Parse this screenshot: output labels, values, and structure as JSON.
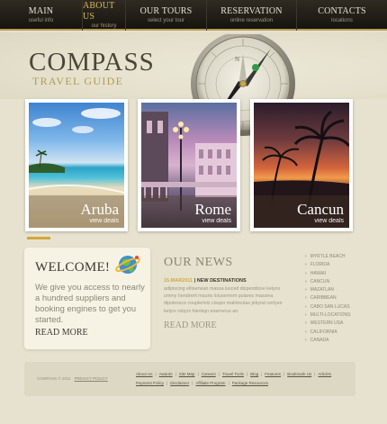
{
  "nav": [
    {
      "title": "MAIN",
      "sub": "useful info",
      "active": false
    },
    {
      "title": "ABOUT US",
      "sub": "our history",
      "active": true
    },
    {
      "title": "OUR TOURS",
      "sub": "select your tour",
      "active": false
    },
    {
      "title": "RESERVATION",
      "sub": "online reservation",
      "active": false
    },
    {
      "title": "CONTACTS",
      "sub": "locations",
      "active": false
    }
  ],
  "header": {
    "logo": "COMPASS",
    "tagline": "TRAVEL GUIDE"
  },
  "cards": [
    {
      "name": "Aruba",
      "link": "view deals"
    },
    {
      "name": "Rome",
      "link": "view deals"
    },
    {
      "name": "Cancun",
      "link": "view deals"
    }
  ],
  "welcome": {
    "title": "WELCOME!",
    "text": "We give you access to nearly a hundred suppliers and booking engines to get you started.",
    "more": "READ MORE"
  },
  "news": {
    "title": "OUR NEWS",
    "date": "15.MAR2011",
    "headline": "NEW DESTINATIONS",
    "body": "adipiscing elitaenean massa lusced dispendisse kelyox ummy hendrerit mauris loluserrism pulares massiea dipolessce couplerivis cisupo maliniculas jekyrat cerlyen kelyrx rebyrx hlenkqn enamvrus an.",
    "more": "READ MORE"
  },
  "destinations": [
    "MYRTLE BEACH",
    "FLORIDA",
    "HAWAII",
    "CANCUN",
    "MAZATLAN",
    "CARIBBEAN",
    "CABO SAN LUCAS",
    "MULTI-LOCATIONS",
    "WESTERN USA",
    "CALIFORNIA",
    "CANADA"
  ],
  "footer": {
    "copyright": "COMPASS © 2011",
    "privacy": "PRIVACY POLICY",
    "links": [
      "About Us",
      "Awards",
      "Site Map",
      "Careers",
      "Travel Tools",
      "Blog",
      "Features",
      "Bookmark Us",
      "Articles",
      "Payment Policy",
      "Disclaimer",
      "Affiliate Program",
      "Package Resources"
    ]
  }
}
